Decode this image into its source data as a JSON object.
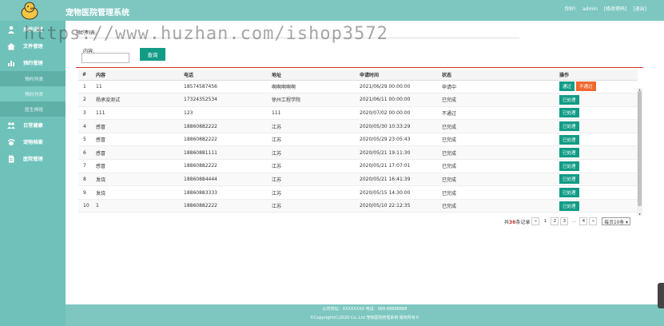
{
  "header": {
    "title": "宠物医院管理系统",
    "greeting": "你好!",
    "username": "admin",
    "change_password": "[修改密码]",
    "logout": "[退出]"
  },
  "sidebar": {
    "items": [
      {
        "label": "系统设置",
        "icon": "person-icon"
      },
      {
        "label": "文件管理",
        "icon": "home-icon"
      },
      {
        "label": "预约管理",
        "icon": "chart-icon"
      },
      {
        "label": "预约列表",
        "sub": true
      },
      {
        "label": "预约列表",
        "sub": true,
        "active": true
      },
      {
        "label": "医生排班",
        "sub": true
      },
      {
        "label": "日常健康",
        "icon": "group-icon"
      },
      {
        "label": "宠物档案",
        "icon": "pet-icon"
      },
      {
        "label": "医院管理",
        "icon": "doc-icon"
      }
    ]
  },
  "breadcrumb": "预约列表:",
  "watermark": "https://www.huzhan.com/ishop3572",
  "search": {
    "label": "内容:",
    "value": "",
    "button": "查询"
  },
  "table": {
    "headers": [
      "#",
      "内容",
      "电话",
      "地址",
      "申请时间",
      "状态",
      "操作"
    ],
    "rows": [
      {
        "idx": "1",
        "name": "11",
        "phone": "18574587456",
        "addr": "啊啊啊啊啊",
        "time": "2021/06/29 00:00:00",
        "status": "申请中",
        "actions": [
          "通过",
          "不通过"
        ]
      },
      {
        "idx": "2",
        "name": "杨承浚测试",
        "phone": "17324352534",
        "addr": "徐州工程学院",
        "time": "2021/06/11 00:00:00",
        "status": "已完成",
        "actions": [
          "已处理"
        ]
      },
      {
        "idx": "3",
        "name": "111",
        "phone": "123",
        "addr": "111",
        "time": "2020/07/02 00:00:00",
        "status": "不通过",
        "actions": [
          "已处理"
        ]
      },
      {
        "idx": "4",
        "name": "感冒",
        "phone": "18860882222",
        "addr": "江苏",
        "time": "2020/05/30 10:33:29",
        "status": "已完成",
        "actions": [
          "已处理"
        ]
      },
      {
        "idx": "5",
        "name": "感冒",
        "phone": "18860882222",
        "addr": "江苏",
        "time": "2020/05/29 23:05:43",
        "status": "已完成",
        "actions": [
          "已处理"
        ]
      },
      {
        "idx": "6",
        "name": "感冒",
        "phone": "18860881111",
        "addr": "江苏",
        "time": "2020/05/21 19:11:30",
        "status": "已完成",
        "actions": [
          "已处理"
        ]
      },
      {
        "idx": "7",
        "name": "感冒",
        "phone": "18860882222",
        "addr": "江苏",
        "time": "2020/05/21 17:07:01",
        "status": "已完成",
        "actions": [
          "已处理"
        ]
      },
      {
        "idx": "8",
        "name": "发烧",
        "phone": "18860884444",
        "addr": "江苏",
        "time": "2020/05/21 16:41:39",
        "status": "已完成",
        "actions": [
          "已处理"
        ]
      },
      {
        "idx": "9",
        "name": "发烧",
        "phone": "18860883333",
        "addr": "江苏",
        "time": "2020/05/15 14:30:00",
        "status": "已完成",
        "actions": [
          "已处理"
        ]
      },
      {
        "idx": "10",
        "name": "1",
        "phone": "18860882222",
        "addr": "江苏",
        "time": "2020/05/10 22:12:35",
        "status": "已完成",
        "actions": [
          "已处理"
        ]
      }
    ]
  },
  "pager": {
    "prefix": "共",
    "total": "36",
    "suffix": "条记录",
    "prev": "«",
    "pages": [
      "1",
      "2",
      "3",
      "...",
      "4"
    ],
    "next": "»",
    "per_page": "每页10条 ▾"
  },
  "footer": {
    "line1": "公司地址：XXXXXXXX 电话：088-88888888",
    "line2": "©Copyright(C)2020 Co.,Ltd 宠物医院管理系统 版权所有©"
  },
  "colors": {
    "header": "#7dc7c0",
    "sidebar": "#6ec2b9",
    "primary": "#129c86",
    "danger": "#f0672e",
    "accent_line": "#c9302c"
  }
}
